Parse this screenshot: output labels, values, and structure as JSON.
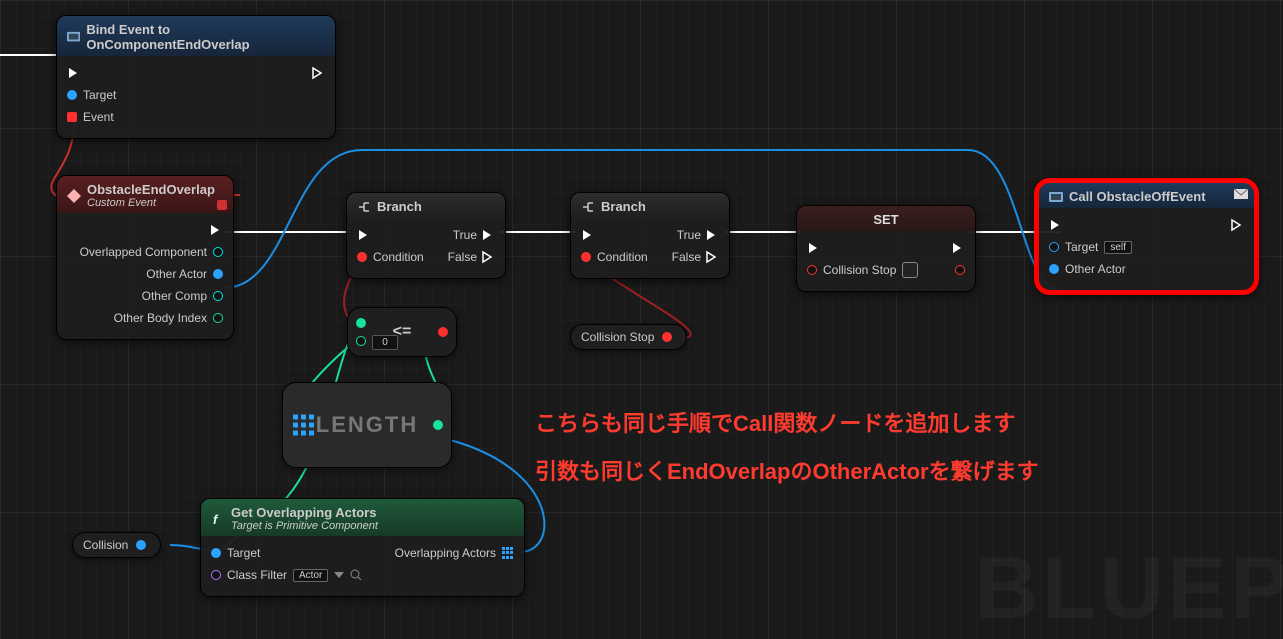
{
  "nodes": {
    "bind": {
      "title": "Bind Event to OnComponentEndOverlap",
      "pins": {
        "target": "Target",
        "event": "Event"
      }
    },
    "customEvent": {
      "title": "ObstacleEndOverlap",
      "subtitle": "Custom Event",
      "pins": {
        "overlappedComponent": "Overlapped Component",
        "otherActor": "Other Actor",
        "otherComp": "Other Comp",
        "otherBodyIndex": "Other Body Index"
      }
    },
    "branch1": {
      "title": "Branch",
      "pins": {
        "condition": "Condition",
        "trueLabel": "True",
        "falseLabel": "False"
      }
    },
    "branch2": {
      "title": "Branch",
      "pins": {
        "condition": "Condition",
        "trueLabel": "True",
        "falseLabel": "False"
      }
    },
    "set": {
      "title": "SET",
      "pins": {
        "collisionStop": "Collision Stop"
      }
    },
    "call": {
      "title": "Call ObstacleOffEvent",
      "pins": {
        "target": "Target",
        "targetValue": "self",
        "otherActor": "Other Actor"
      }
    },
    "compare": {
      "op": "<=",
      "default": "0"
    },
    "length": {
      "label": "LENGTH"
    },
    "collisionStopPill": {
      "label": "Collision Stop"
    },
    "collisionPill": {
      "label": "Collision"
    },
    "getOverlap": {
      "title": "Get Overlapping Actors",
      "subtitle": "Target is Primitive Component",
      "pins": {
        "target": "Target",
        "classFilter": "Class Filter",
        "actorLabel": "Actor",
        "overlapping": "Overlapping Actors"
      }
    }
  },
  "annotations": {
    "line1": "こちらも同じ手順でCall関数ノードを追加します",
    "line2": "引数も同じくEndOverlapのOtherActorを繋げます"
  },
  "watermark": "BLUEP"
}
